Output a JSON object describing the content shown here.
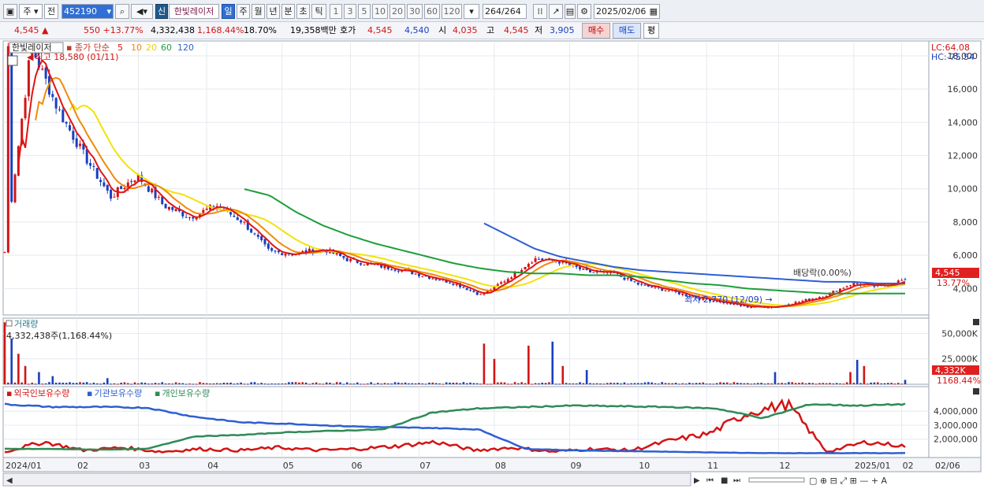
{
  "toolbar": {
    "market": "주",
    "compare": "전",
    "code": "452190",
    "badge": "신",
    "name": "한빛레이저",
    "periods": [
      "일",
      "주",
      "월",
      "년",
      "분",
      "초",
      "틱"
    ],
    "intervals": [
      "1",
      "3",
      "5",
      "10",
      "20",
      "30",
      "60",
      "120"
    ],
    "count": "264",
    "total": "/264",
    "date": "2025/02/06"
  },
  "info": {
    "price": "4,545",
    "change": "550",
    "change_pct": "+13.77%",
    "volume": "4,332,438",
    "volume_ratio": "1,168.44%",
    "turnover": "18.70%",
    "amount": "19,358백만",
    "quote_label": "호가",
    "ask": "4,545",
    "bid": "4,540",
    "open_label": "시",
    "open": "4,035",
    "high_label": "고",
    "high": "4,545",
    "low_label": "저",
    "low": "3,905",
    "buy_label": "매수",
    "sell_label": "매도",
    "flat_label": "평"
  },
  "price_panel": {
    "title": "한빛레이저",
    "indicator": "종가 단순",
    "ma_periods": [
      "5",
      "10",
      "20",
      "60",
      "120"
    ],
    "high_annotation": "최고 18,580 (01/11)",
    "low_annotation": "최저 2,770 (12/09)",
    "dividend_annotation": "배당락(0.00%)",
    "lc_label": "LC:64.08",
    "hc_label": "HC:-75.54",
    "y_ticks": [
      "18,000",
      "16,000",
      "14,000",
      "12,000",
      "10,000",
      "8,000",
      "6,000",
      "4,000"
    ],
    "current_price_tag": "4,545",
    "current_change_tag": "13.77%"
  },
  "volume_panel": {
    "title": "거래량",
    "value_label": "4,332,438주(1,168.44%)",
    "y_ticks": [
      "50,000K",
      "25,000K"
    ],
    "current_tag": "4,332K",
    "ratio_tag": "1168.44%"
  },
  "holdings_panel": {
    "series_labels": [
      "외국인보유수량",
      "기관보유수량",
      "개인보유수량"
    ],
    "y_ticks": [
      "4,000,000",
      "3,000,000",
      "2,000,000"
    ]
  },
  "x_axis": {
    "labels": [
      "2024/01",
      "02",
      "03",
      "04",
      "05",
      "06",
      "07",
      "08",
      "09",
      "10",
      "11",
      "12",
      "2025/01",
      "02"
    ],
    "right_label": "02/06"
  },
  "colors": {
    "up": "#d21414",
    "down": "#1a3fbf",
    "ma5": "#e01414",
    "ma10": "#f08a0a",
    "ma20": "#f2e20a",
    "ma60": "#1e9e3a",
    "ma120": "#2f5fd0",
    "foreign": "#d21414",
    "institution": "#2f5fd0",
    "individual": "#2e8b57"
  },
  "chart_data": [
    {
      "type": "candlestick",
      "title": "한빛레이저",
      "ylim": [
        2500,
        18800
      ],
      "x_months": [
        "2024/01",
        "02",
        "03",
        "04",
        "05",
        "06",
        "07",
        "08",
        "09",
        "10",
        "11",
        "12",
        "2025/01",
        "02"
      ],
      "close_keypoints": [
        6200,
        18580,
        14800,
        12000,
        9500,
        10800,
        9000,
        8300,
        9000,
        8000,
        6200,
        6100,
        6400,
        5700,
        5400,
        5100,
        4700,
        4300,
        3600,
        4600,
        5800,
        5600,
        5000,
        4900,
        4200,
        3900,
        3500,
        3200,
        2900,
        2900,
        3200,
        3600,
        4300,
        4100,
        4545
      ],
      "ma60": [
        null,
        null,
        null,
        null,
        null,
        null,
        null,
        null,
        null,
        10000,
        9600,
        8600,
        7800,
        7200,
        6700,
        6300,
        5900,
        5500,
        5200,
        5000,
        4900,
        4900,
        4800,
        4800,
        4700,
        4500,
        4300,
        4200,
        4000,
        3900,
        3800,
        3700,
        3700,
        3700,
        3700
      ],
      "ma120": [
        null,
        null,
        null,
        null,
        null,
        null,
        null,
        null,
        null,
        null,
        null,
        null,
        null,
        null,
        null,
        null,
        null,
        null,
        8000,
        7200,
        6400,
        5900,
        5600,
        5300,
        5100,
        5000,
        4900,
        4800,
        4700,
        4600,
        4500,
        4400,
        4400,
        4300,
        4300
      ],
      "annotations": [
        "최고 18,580 (01/11)",
        "최저 2,770 (12/09)",
        "배당락(0.00%)"
      ]
    },
    {
      "type": "bar",
      "title": "거래량",
      "ylim": [
        0,
        62000
      ],
      "unit": "K",
      "last_value": 4332,
      "spikes_k": [
        61000,
        45000,
        30000,
        18000,
        12000,
        8000,
        6000,
        40000,
        25000,
        38000,
        42000,
        18000,
        14000,
        12000,
        12000,
        24000,
        18000
      ]
    },
    {
      "type": "line",
      "title": "보유수량",
      "series": [
        {
          "name": "외국인보유수량",
          "keypoints": [
            1100000,
            1800000,
            1200000,
            1400000,
            1100000,
            1300000,
            1200000,
            1400000,
            1200000,
            1300000,
            1500000,
            1800000,
            1200000,
            1400000,
            1100000,
            1300000,
            1200000,
            1900000,
            2400000,
            3900000,
            4500000,
            1100000,
            1800000,
            1500000
          ]
        },
        {
          "name": "기관보유수량",
          "keypoints": [
            4500000,
            4300000,
            4300000,
            4250000,
            3600000,
            3200000,
            3100000,
            2950000,
            2850000,
            2800000,
            2700000,
            1300000,
            1200000,
            1150000,
            1100000,
            1050000,
            1000000,
            1000000,
            1000000,
            1000000
          ]
        },
        {
          "name": "개인보유수량",
          "keypoints": [
            1300000,
            1300000,
            1250000,
            1300000,
            2200000,
            2300000,
            2500000,
            2600000,
            2700000,
            3900000,
            4200000,
            4300000,
            4400000,
            4350000,
            4300000,
            4200000,
            3500000,
            4500000,
            4400000,
            4500000
          ]
        }
      ],
      "ylim": [
        800000,
        4800000
      ]
    }
  ]
}
